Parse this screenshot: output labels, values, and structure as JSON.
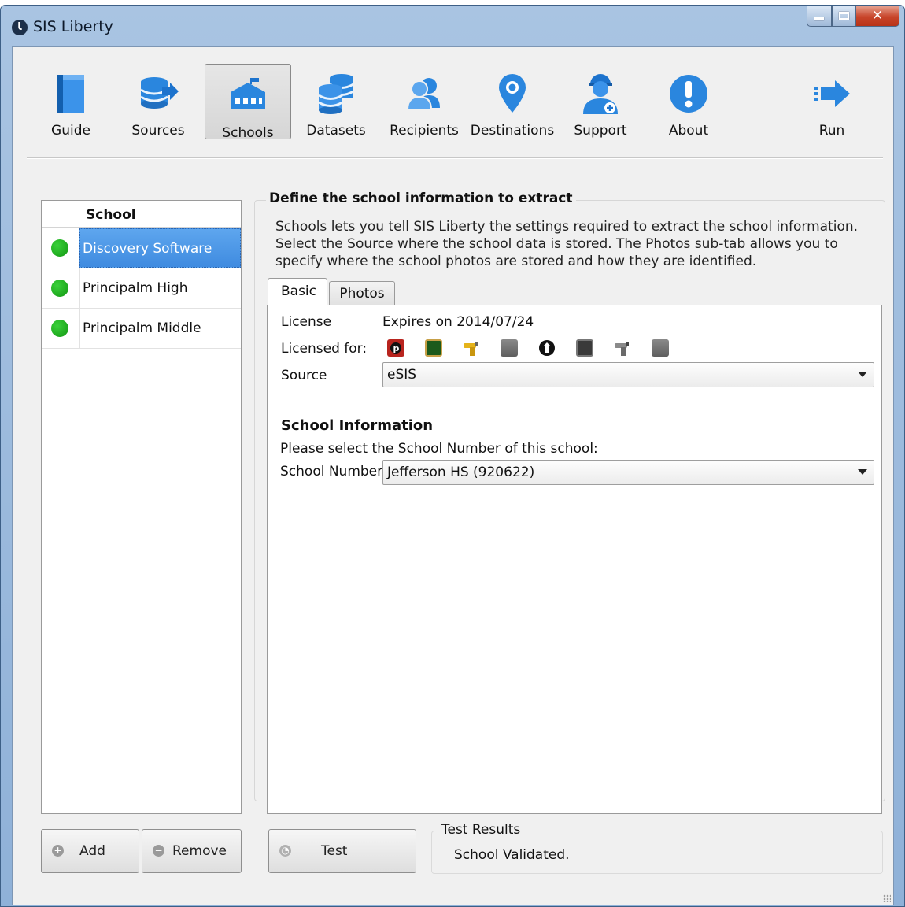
{
  "window": {
    "title": "SIS Liberty",
    "logo_text": "Ɩ"
  },
  "toolbar": {
    "items": [
      {
        "label": "Guide",
        "icon": "book-icon",
        "active": false
      },
      {
        "label": "Sources",
        "icon": "database-arrow-icon",
        "active": false
      },
      {
        "label": "Schools",
        "icon": "school-building-icon",
        "active": true
      },
      {
        "label": "Datasets",
        "icon": "database-stack-icon",
        "active": false
      },
      {
        "label": "Recipients",
        "icon": "users-icon",
        "active": false
      },
      {
        "label": "Destinations",
        "icon": "map-pin-icon",
        "active": false
      },
      {
        "label": "Support",
        "icon": "support-agent-icon",
        "active": false
      },
      {
        "label": "About",
        "icon": "exclamation-icon",
        "active": false
      },
      {
        "label": "Run",
        "icon": "arrow-right-icon",
        "active": false
      }
    ]
  },
  "school_list": {
    "column_header": "School",
    "rows": [
      {
        "name": "Discovery Software",
        "selected": true
      },
      {
        "name": "Principalm High",
        "selected": false
      },
      {
        "name": "Principalm Middle",
        "selected": false
      }
    ],
    "add_label": "Add",
    "remove_label": "Remove"
  },
  "define": {
    "title": "Define the school information to extract",
    "description": "Schools lets you tell SIS Liberty the settings required to extract the school information.  Select the Source where the school data is stored.  The Photos sub-tab allows you to specify where the school photos are stored and how they are identified."
  },
  "tabs": {
    "basic": "Basic",
    "photos": "Photos"
  },
  "basic": {
    "license_label": "License",
    "license_value": "Expires on 2014/07/24",
    "licensed_for_label": "Licensed for:",
    "licensed_for_icons": [
      "powerschool-icon",
      "chalkboard-icon",
      "yellow-camera-icon",
      "gray-id-card-icon",
      "black-emblem-icon",
      "dark-chalkboard-icon",
      "gray-camera-icon",
      "gray-id-card-icon"
    ],
    "source_label": "Source",
    "source_value": "eSIS",
    "school_info_heading": "School Information",
    "school_info_prompt": "Please select the School Number of this school:",
    "school_number_label": "School Number",
    "school_number_value": "Jefferson HS (920622)"
  },
  "test": {
    "button_label": "Test",
    "results_title": "Test Results",
    "results_text": "School Validated."
  },
  "colors": {
    "accent_blue": "#2f86e0",
    "status_green": "#1db81d",
    "selection_blue": "#4a94e6"
  }
}
